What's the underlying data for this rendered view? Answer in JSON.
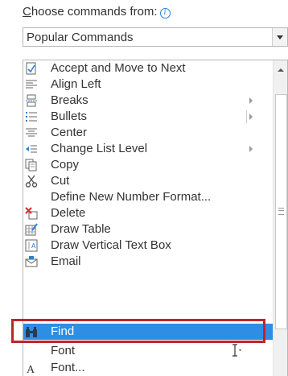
{
  "header": {
    "label_first": "C",
    "label_rest": "hoose commands from:",
    "info_icon": "info-icon"
  },
  "combo": {
    "value": "Popular Commands"
  },
  "commands": [
    {
      "label": "Accept and Move to Next",
      "icon": "accept-icon"
    },
    {
      "label": "Align Left",
      "icon": "align-left-icon"
    },
    {
      "label": "Breaks",
      "icon": "breaks-icon",
      "submenu": true
    },
    {
      "label": "Bullets",
      "icon": "bullets-icon",
      "split": true
    },
    {
      "label": "Center",
      "icon": "center-icon"
    },
    {
      "label": "Change List Level",
      "icon": "change-list-level-icon",
      "submenu": true
    },
    {
      "label": "Copy",
      "icon": "copy-icon"
    },
    {
      "label": "Cut",
      "icon": "scissors-icon"
    },
    {
      "label": "Define New Number Format...",
      "icon": ""
    },
    {
      "label": "Delete",
      "icon": "delete-icon"
    },
    {
      "label": "Draw Table",
      "icon": "draw-table-icon"
    },
    {
      "label": "Draw Vertical Text Box",
      "icon": "vertical-text-box-icon"
    },
    {
      "label": "Email",
      "icon": "email-icon"
    },
    {
      "label": "Find",
      "icon": "binoculars-icon",
      "selected": true
    },
    {
      "label": "Font",
      "icon": ""
    },
    {
      "label": "Font...",
      "icon": "font-icon"
    }
  ],
  "colors": {
    "selection": "#2e8ee3",
    "highlight_outline": "#c0242b"
  }
}
